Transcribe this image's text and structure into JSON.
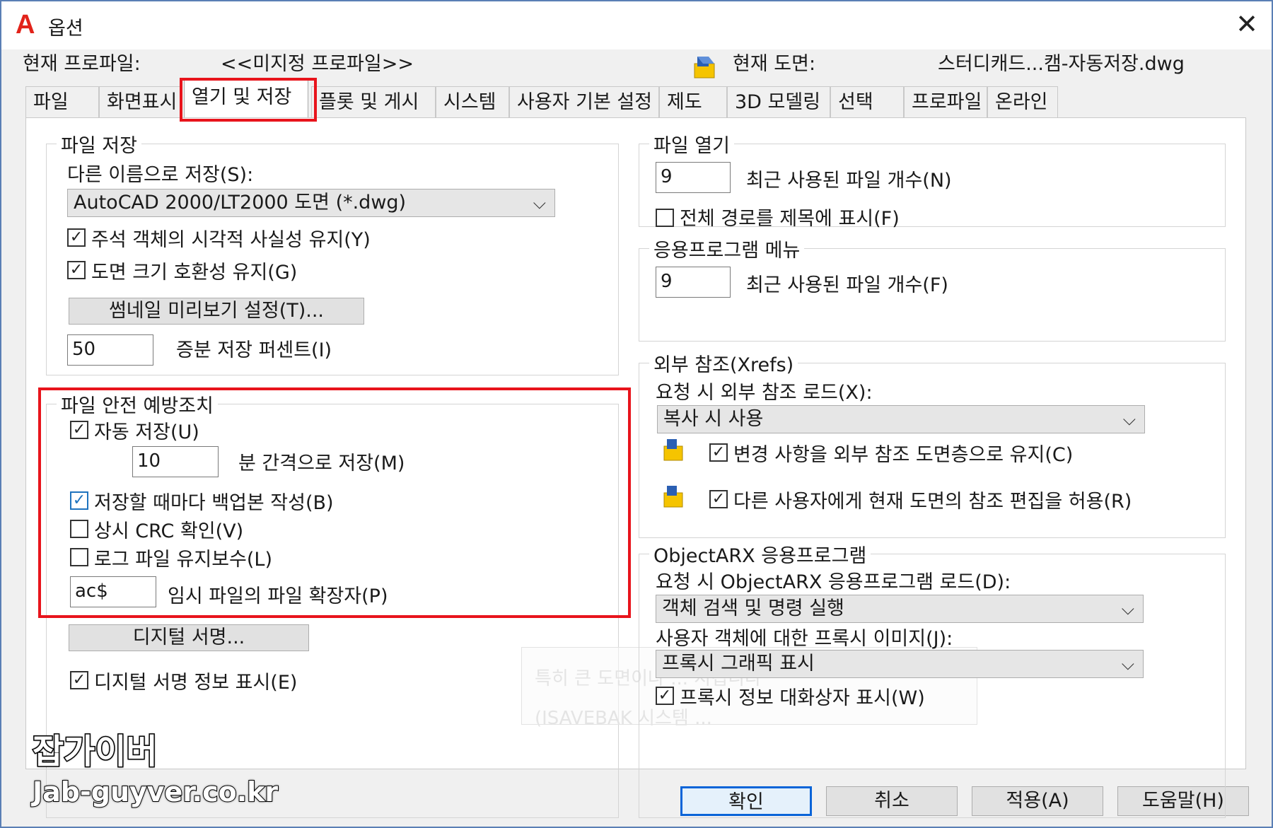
{
  "window": {
    "title": "옵션",
    "close_glyph": "✕"
  },
  "profile": {
    "current_profile_label": "현재 프로파일:",
    "current_profile_value": "<<미지정 프로파일>>",
    "current_drawing_label": "현재 도면:",
    "current_drawing_value": "스터디캐드...캠-자동저장.dwg"
  },
  "tabs": [
    {
      "label": "파일"
    },
    {
      "label": "화면표시"
    },
    {
      "label": "열기 및 저장",
      "active": true
    },
    {
      "label": "플롯 및 게시"
    },
    {
      "label": "시스템"
    },
    {
      "label": "사용자 기본 설정"
    },
    {
      "label": "제도"
    },
    {
      "label": "3D 모델링"
    },
    {
      "label": "선택"
    },
    {
      "label": "프로파일"
    },
    {
      "label": "온라인"
    }
  ],
  "file_save": {
    "title": "파일 저장",
    "save_as_label": "다른 이름으로 저장(S):",
    "save_as_value": "AutoCAD 2000/LT2000 도면 (*.dwg)",
    "annot_visual": {
      "label": "주석 객체의 시각적 사실성 유지(Y)",
      "checked": true
    },
    "drawing_size": {
      "label": "도면 크기 호환성 유지(G)",
      "checked": true
    },
    "thumbnail_button": "썸네일 미리보기 설정(T)...",
    "incremental_value": "50",
    "incremental_label": "증분 저장 퍼센트(I)"
  },
  "file_safety": {
    "title": "파일 안전 예방조치",
    "autosave": {
      "label": "자동 저장(U)",
      "checked": true
    },
    "interval_value": "10",
    "interval_label": "분 간격으로 저장(M)",
    "backup": {
      "label": "저장할 때마다 백업본 작성(B)",
      "checked": true
    },
    "crc": {
      "label": "상시 CRC 확인(V)",
      "checked": false
    },
    "log": {
      "label": "로그 파일 유지보수(L)",
      "checked": false
    },
    "temp_ext_value": "ac$",
    "temp_ext_label": "임시 파일의 파일 확장자(P)",
    "digital_sig_button": "디지털 서명...",
    "digital_sig_info": {
      "label": "디지털 서명 정보 표시(E)",
      "checked": true
    }
  },
  "file_open": {
    "title": "파일 열기",
    "recent_value": "9",
    "recent_label": "최근 사용된 파일 개수(N)",
    "full_path": {
      "label": "전체 경로를 제목에 표시(F)",
      "checked": false
    }
  },
  "app_menu": {
    "title": "응용프로그램 메뉴",
    "recent_value": "9",
    "recent_label": "최근 사용된 파일 개수(F)"
  },
  "xrefs": {
    "title": "외부 참조(Xrefs)",
    "demand_load_label": "요청 시 외부 참조 로드(X):",
    "demand_load_value": "복사 시 사용",
    "retain_changes": {
      "label": "변경 사항을 외부 참조 도면층으로 유지(C)",
      "checked": true
    },
    "allow_edit": {
      "label": "다른 사용자에게 현재 도면의 참조 편집을 허용(R)",
      "checked": true
    }
  },
  "objectarx": {
    "title": "ObjectARX 응용프로그램",
    "demand_load_label": "요청 시 ObjectARX 응용프로그램 로드(D):",
    "demand_load_value": "객체 검색 및 명령 실행",
    "proxy_label": "사용자 객체에 대한 프록시 이미지(J):",
    "proxy_value": "프록시 그래픽 표시",
    "proxy_dialog": {
      "label": "프록시 정보 대화상자 표시(W)",
      "checked": true
    }
  },
  "tooltip_ghost": {
    "line1": "특히 큰 도면이나 ... 시킵니다",
    "line2": "(ISAVEBAK 시스템 ..."
  },
  "footer": {
    "ok": "확인",
    "cancel": "취소",
    "apply": "적용(A)",
    "help": "도움말(H)"
  },
  "watermark": {
    "name": "잡가이버",
    "url": "Jab-guyver.co.kr"
  },
  "colors": {
    "highlight_red": "#e8141c",
    "autocad_red": "#e2231a",
    "default_button_border": "#0a64d8"
  }
}
